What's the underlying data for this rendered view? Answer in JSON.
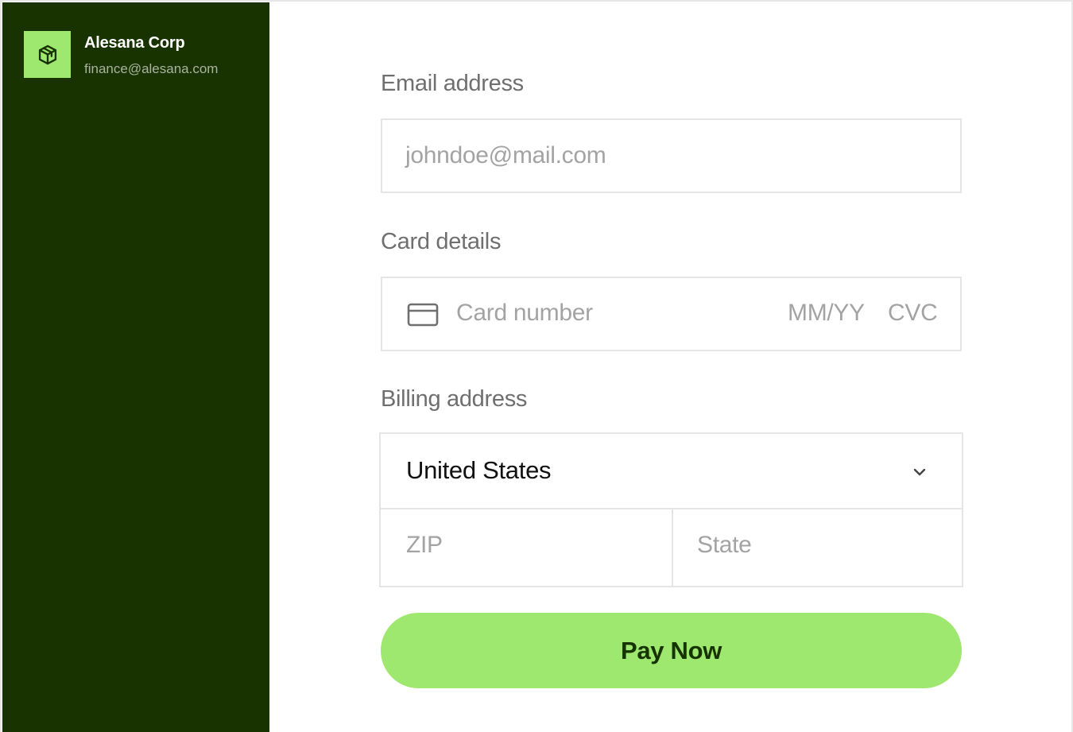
{
  "company": {
    "name": "Alesana Corp",
    "email": "finance@alesana.com",
    "logo_icon": "cube-icon"
  },
  "form": {
    "email": {
      "label": "Email address",
      "placeholder": "johndoe@mail.com",
      "value": ""
    },
    "card": {
      "label": "Card details",
      "icon": "credit-card-icon",
      "number_placeholder": "Card number",
      "expiry_placeholder": "MM/YY",
      "cvc_placeholder": "CVC"
    },
    "billing": {
      "label": "Billing address",
      "country": "United States",
      "zip_placeholder": "ZIP",
      "state_placeholder": "State"
    },
    "submit_label": "Pay Now"
  },
  "colors": {
    "sidebar_bg": "#183300",
    "accent": "#9fe870",
    "button_text": "#163300"
  }
}
